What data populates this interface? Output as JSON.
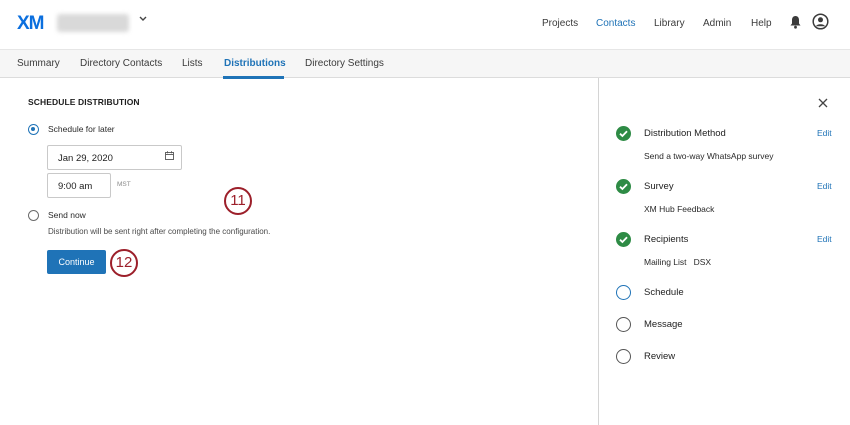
{
  "header": {
    "logo": "XM",
    "nav": [
      "Projects",
      "Contacts",
      "Library",
      "Admin",
      "Help"
    ],
    "active_nav": "Contacts"
  },
  "tabs": [
    "Summary",
    "Directory Contacts",
    "Lists",
    "Distributions",
    "Directory Settings"
  ],
  "active_tab": "Distributions",
  "schedule": {
    "title": "SCHEDULE DISTRIBUTION",
    "option_later": "Schedule for later",
    "date": "Jan 29, 2020",
    "time": "9:00 am",
    "timezone": "MST",
    "option_now": "Send now",
    "helper": "Distribution will be sent right after completing the configuration.",
    "continue": "Continue",
    "selected": "later"
  },
  "callouts": [
    "11",
    "12"
  ],
  "steps": [
    {
      "title": "Distribution Method",
      "subtitle": "Send a two-way WhatsApp survey",
      "status": "done",
      "edit": "Edit"
    },
    {
      "title": "Survey",
      "subtitle": "XM Hub Feedback",
      "status": "done",
      "edit": "Edit"
    },
    {
      "title": "Recipients",
      "subtitle": "Mailing List   DSX",
      "status": "done",
      "edit": "Edit"
    },
    {
      "title": "Schedule",
      "subtitle": "",
      "status": "current",
      "edit": ""
    },
    {
      "title": "Message",
      "subtitle": "",
      "status": "todo",
      "edit": ""
    },
    {
      "title": "Review",
      "subtitle": "",
      "status": "todo",
      "edit": ""
    }
  ],
  "colors": {
    "accent": "#1f73b7",
    "done": "#2e8b45",
    "callout": "#9c1f2a"
  }
}
